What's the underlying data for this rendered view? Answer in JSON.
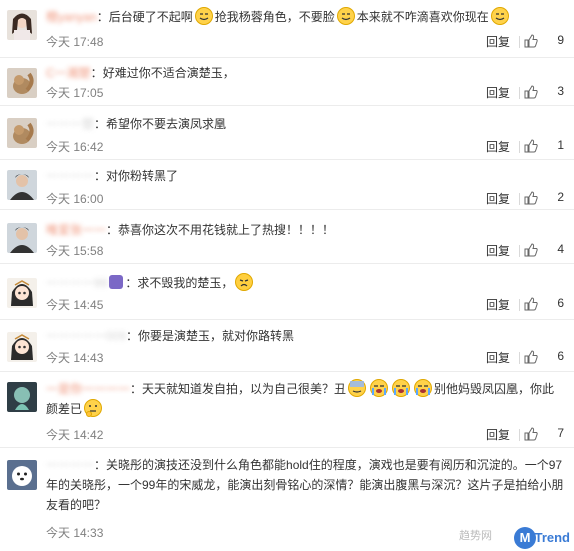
{
  "reply_label": "回复",
  "comments": [
    {
      "user": "橙yanyan",
      "segments": [
        "后台硬了不起啊",
        "抢我杨蓉角色，不要脸",
        "本来就不咋滴喜欢你现在"
      ],
      "time": "今天 17:48",
      "likes": "9",
      "avatar": "girl-avatar"
    },
    {
      "user": "C一湘楚",
      "segments": [
        "好难过你不适合演楚玉，"
      ],
      "time": "今天 17:05",
      "likes": "3",
      "avatar": "squirrel-avatar"
    },
    {
      "user": "一一一楚",
      "segments": [
        "希望你不要去演凤求凰"
      ],
      "time": "今天 16:42",
      "likes": "1",
      "avatar": "squirrel-avatar"
    },
    {
      "user": "一一一一",
      "segments": [
        "对你粉转黑了"
      ],
      "time": "今天 16:00",
      "likes": "2",
      "avatar": "man-avatar"
    },
    {
      "user": "唯爱张一一",
      "segments": [
        "恭喜你这次不用花钱就上了热搜！！！！"
      ],
      "time": "今天 15:58",
      "likes": "4",
      "avatar": "man-avatar"
    },
    {
      "user": "一一一一99",
      "segments": [
        "求不毁我的楚玉，"
      ],
      "time": "今天 14:45",
      "likes": "6",
      "avatar": "anime-avatar"
    },
    {
      "user": "一一一一一009",
      "segments": [
        "你要是演楚玉，就对你路转黑"
      ],
      "time": "今天 14:43",
      "likes": "6",
      "avatar": "anime-avatar"
    },
    {
      "user": "一是你一一一一",
      "segments": [
        "天天就知道发自拍，以为自己很美？丑",
        "别他妈毁凤囚凰，你此颜差已"
      ],
      "time": "今天 14:42",
      "likes": "7",
      "avatar": "ghost-avatar"
    },
    {
      "user": "一一一一",
      "segments": [
        "关晓彤的演技还没到什么角色都能hold住的程度，演戏也是要有阅历和沉淀的。一个97年的关晓彤，一个99年的宋威龙，能演出刻骨铭心的深情？能演出腹黑与深沉？这片子是拍给小朋友看的吧？"
      ],
      "time": "今天 14:33",
      "likes": "",
      "avatar": "dog-avatar"
    }
  ],
  "watermark": {
    "left": "趋势网",
    "circle": "M",
    "right": "Trend"
  },
  "colors": {
    "username": "#eb7350",
    "meta": "#808080"
  }
}
